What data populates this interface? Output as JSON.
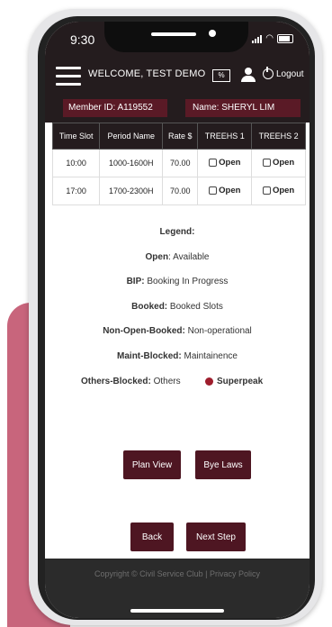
{
  "status": {
    "time": "9:30"
  },
  "header": {
    "welcome": "WELCOME, TEST DEMO",
    "percent_icon": "%",
    "logout": "Logout",
    "member_id": "Member ID: A119552",
    "name": "Name: SHERYL LIM"
  },
  "table": {
    "headers": [
      "Time Slot",
      "Period Name",
      "Rate $",
      "TREEHS 1",
      "TREEHS 2"
    ],
    "rows": [
      {
        "time": "10:00",
        "period": "1000-1600H",
        "rate": "70.00",
        "t1": "Open",
        "t2": "Open"
      },
      {
        "time": "17:00",
        "period": "1700-2300H",
        "rate": "70.00",
        "t1": "Open",
        "t2": "Open"
      }
    ]
  },
  "legend": {
    "title": "Legend:",
    "items": [
      {
        "key": "Open",
        "desc": "Available"
      },
      {
        "key": "BIP:",
        "desc": "Booking In Progress"
      },
      {
        "key": "Booked:",
        "desc": "Booked Slots"
      },
      {
        "key": "Non-Open-Booked:",
        "desc": "Non-operational"
      },
      {
        "key": "Maint-Blocked:",
        "desc": "Maintainence"
      },
      {
        "key": "Others-Blocked:",
        "desc": "Others"
      }
    ],
    "superpeak": "Superpeak",
    "superpeak_color": "#9e1d2c"
  },
  "buttons": {
    "plan_view": "Plan View",
    "bye_laws": "Bye Laws",
    "back": "Back",
    "next_step": "Next Step"
  },
  "footer": {
    "copyright": "Copyright © Civil Service Club | Privacy Policy"
  },
  "colors": {
    "header_bg": "#241c1e",
    "accent": "#4e1622",
    "pink": "#c8657c"
  }
}
